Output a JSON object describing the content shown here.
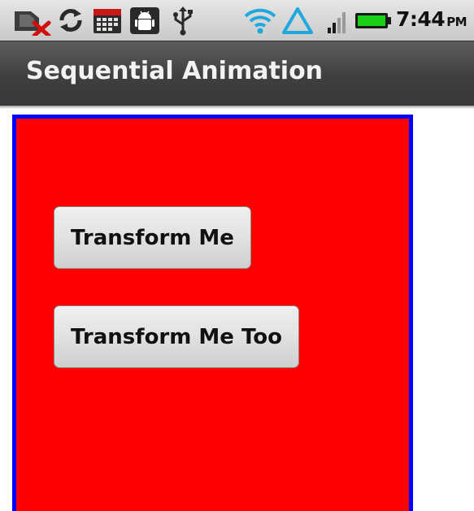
{
  "status_bar": {
    "icons": [
      "no-sim-icon",
      "sync-icon",
      "calendar-icon",
      "android-debug-icon",
      "usb-icon",
      "wifi-icon",
      "warning-triangle-icon",
      "signal-strength-icon",
      "battery-icon"
    ],
    "time": "7:44",
    "ampm": "PM"
  },
  "title_bar": {
    "title": "Sequential Animation"
  },
  "content": {
    "panel_background": "#ff0000",
    "panel_border": "#0000ff",
    "buttons": [
      {
        "label": "Transform Me"
      },
      {
        "label": "Transform Me Too"
      }
    ]
  }
}
